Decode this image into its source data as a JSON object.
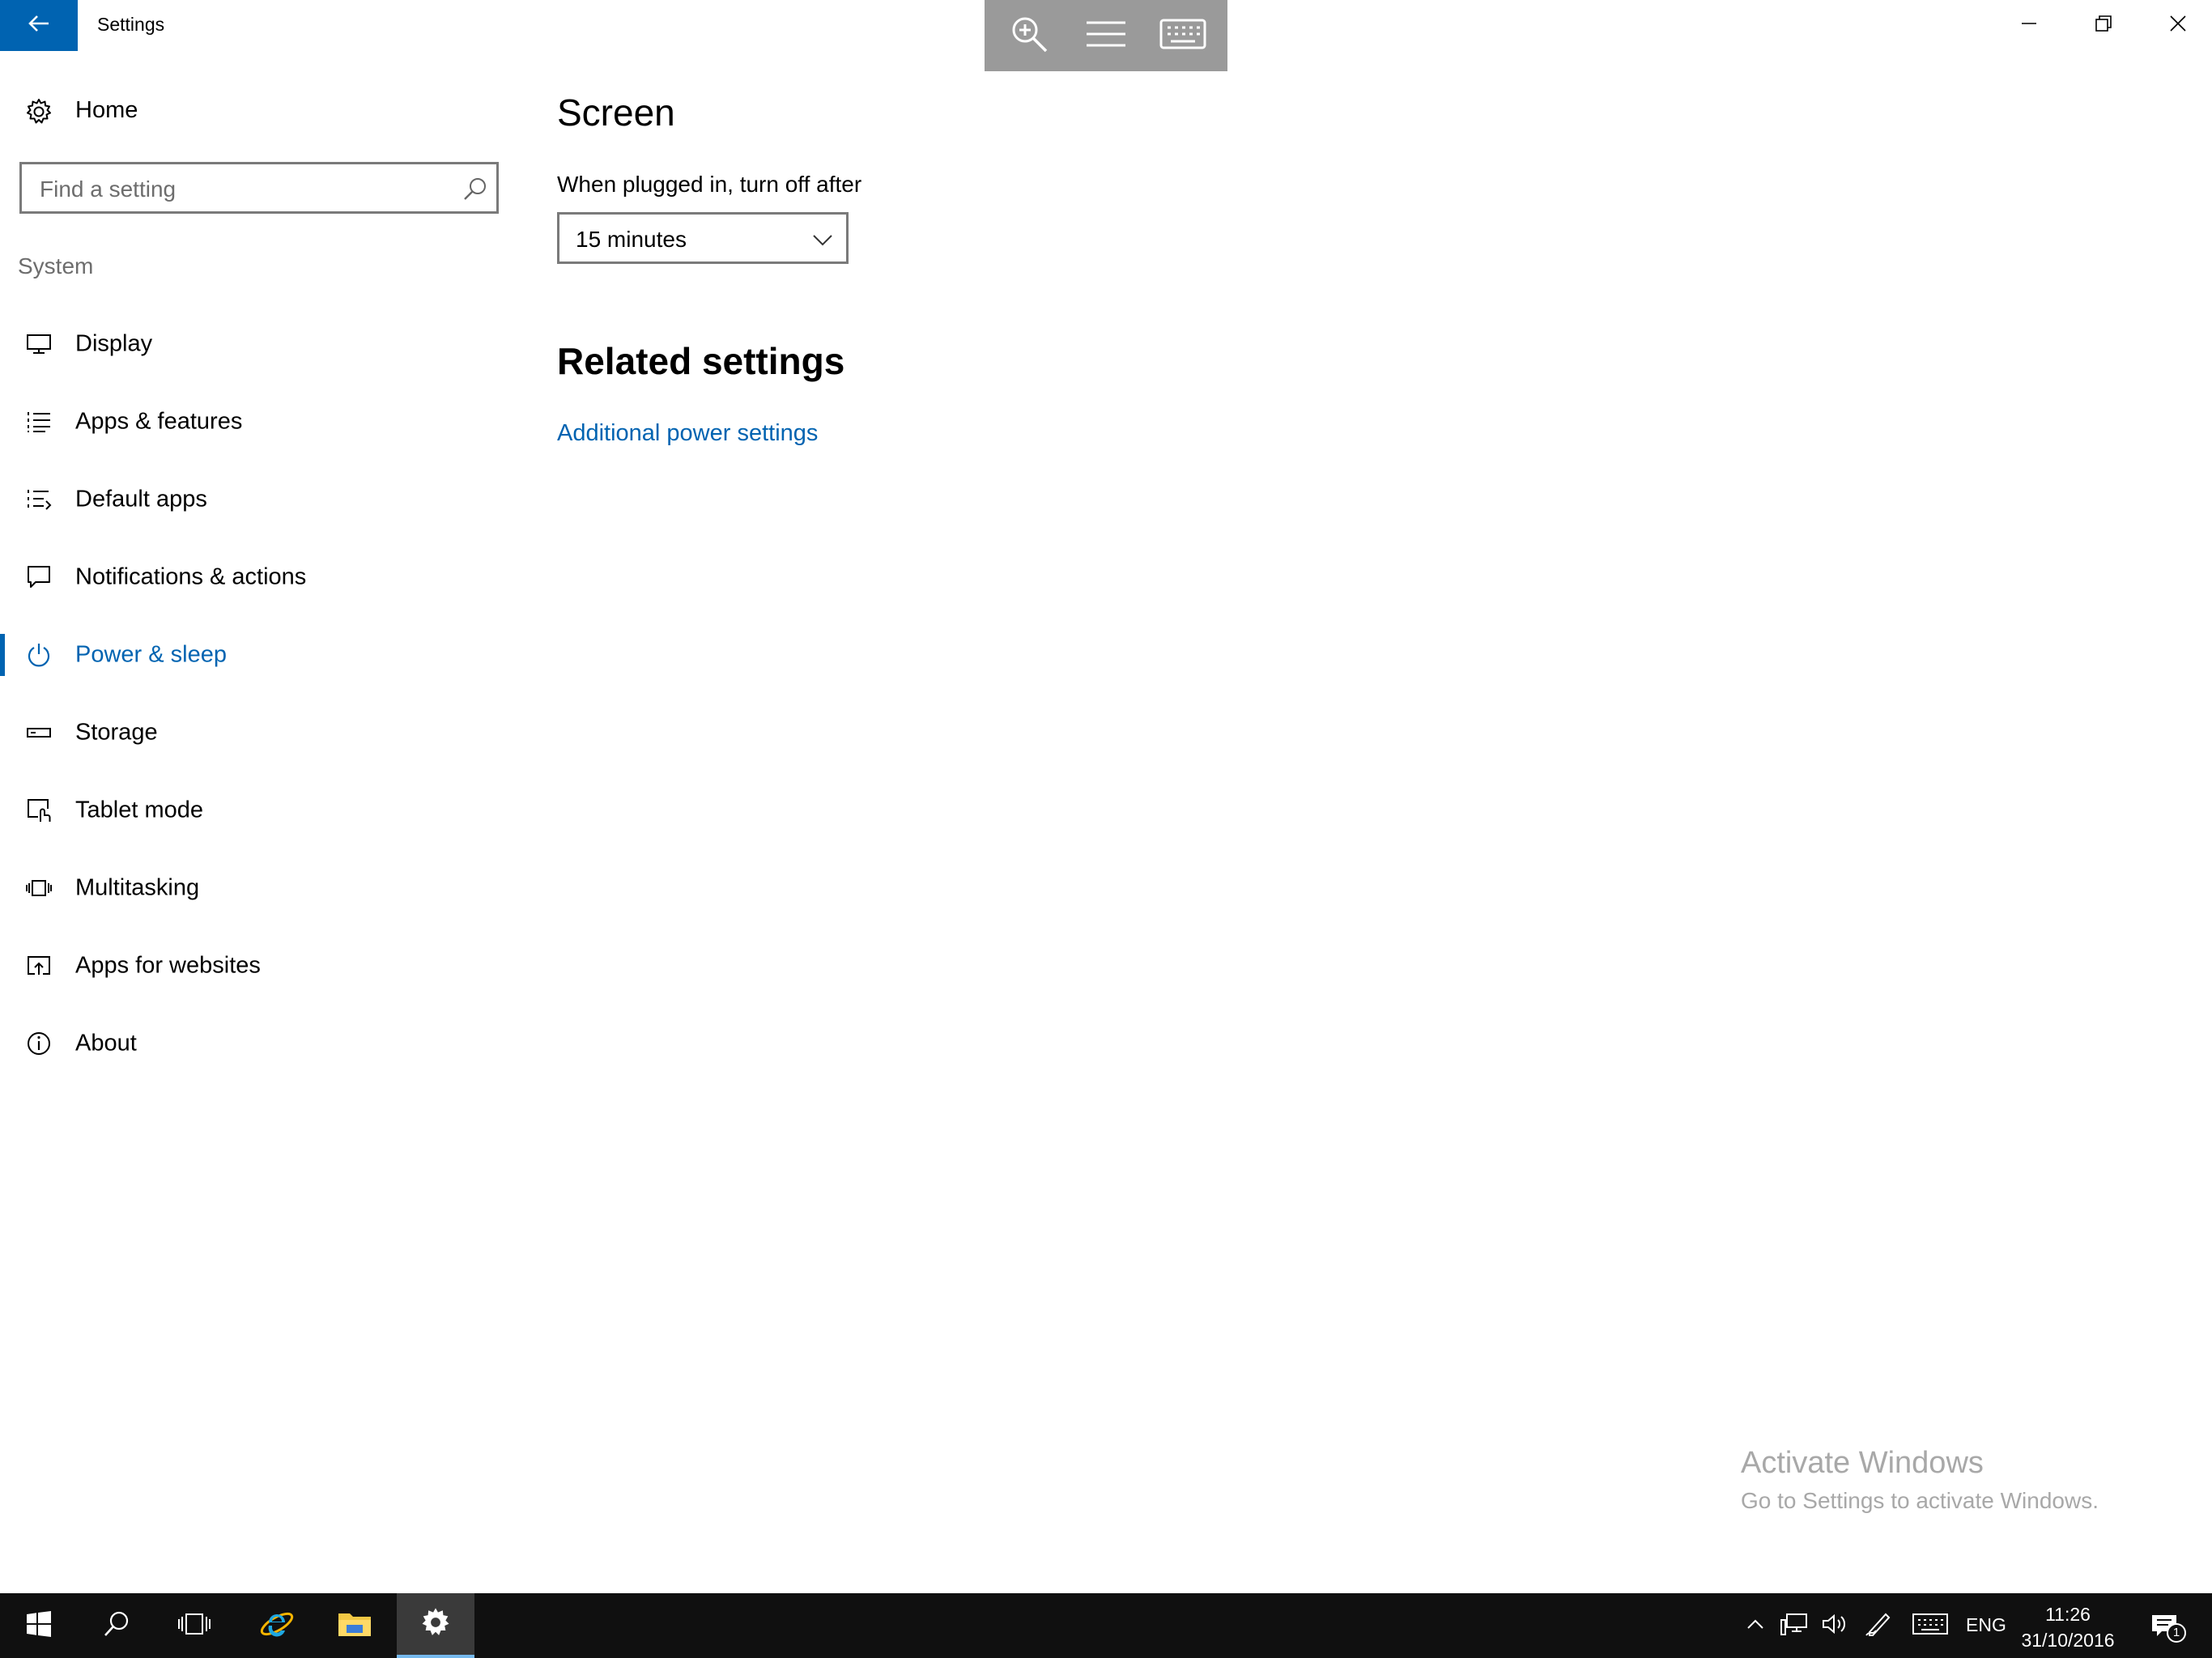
{
  "window": {
    "title": "Settings"
  },
  "sidebar": {
    "home_label": "Home",
    "search_placeholder": "Find a setting",
    "section_label": "System",
    "items": [
      {
        "label": "Display"
      },
      {
        "label": "Apps & features"
      },
      {
        "label": "Default apps"
      },
      {
        "label": "Notifications & actions"
      },
      {
        "label": "Power & sleep",
        "selected": true
      },
      {
        "label": "Storage"
      },
      {
        "label": "Tablet mode"
      },
      {
        "label": "Multitasking"
      },
      {
        "label": "Apps for websites"
      },
      {
        "label": "About"
      }
    ]
  },
  "main": {
    "screen_heading": "Screen",
    "plugged_label": "When plugged in, turn off after",
    "plugged_value": "15 minutes",
    "related_heading": "Related settings",
    "related_link": "Additional power settings"
  },
  "watermark": {
    "title": "Activate Windows",
    "subtitle": "Go to Settings to activate Windows."
  },
  "taskbar": {
    "language": "ENG",
    "time": "11:26",
    "date": "31/10/2016",
    "notification_count": "1"
  },
  "colors": {
    "accent": "#0063b1",
    "taskbar": "#101010",
    "touch_toolbar": "#9a9a9a"
  }
}
